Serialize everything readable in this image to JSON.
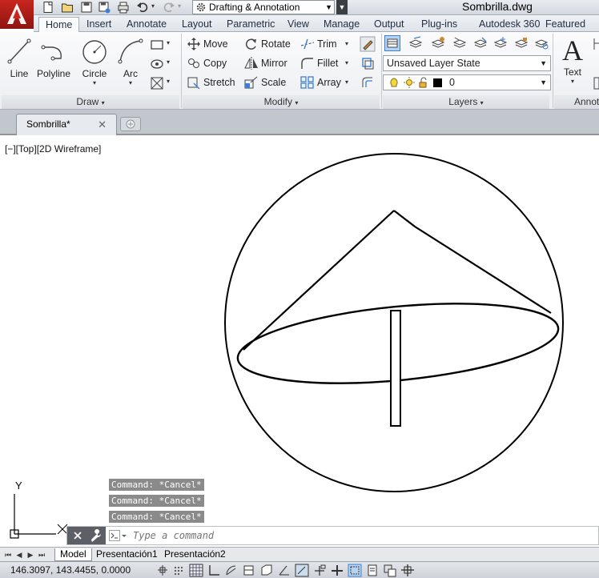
{
  "title_bar": {
    "workspace": "Drafting & Annotation",
    "document_title": "Sombrilla.dwg"
  },
  "ribbon_tabs": [
    {
      "label": "Home"
    },
    {
      "label": "Insert"
    },
    {
      "label": "Annotate"
    },
    {
      "label": "Layout"
    },
    {
      "label": "Parametric"
    },
    {
      "label": "View"
    },
    {
      "label": "Manage"
    },
    {
      "label": "Output"
    },
    {
      "label": "Plug-ins"
    },
    {
      "label": "Autodesk 360"
    },
    {
      "label": "Featured App"
    }
  ],
  "panels": {
    "draw": {
      "title": "Draw",
      "tools": [
        {
          "label": "Line"
        },
        {
          "label": "Polyline"
        },
        {
          "label": "Circle"
        },
        {
          "label": "Arc"
        }
      ]
    },
    "modify": {
      "title": "Modify",
      "tools": [
        {
          "label": "Move"
        },
        {
          "label": "Rotate"
        },
        {
          "label": "Trim"
        },
        {
          "label": "Copy"
        },
        {
          "label": "Mirror"
        },
        {
          "label": "Fillet"
        },
        {
          "label": "Stretch"
        },
        {
          "label": "Scale"
        },
        {
          "label": "Array"
        }
      ]
    },
    "layers": {
      "title": "Layers",
      "layer_state": "Unsaved Layer State",
      "current_layer": "0",
      "current_color": "#000000"
    },
    "annotation": {
      "title": "Annot",
      "text_tool": "Text"
    }
  },
  "file_tab": {
    "label": "Sombrilla*"
  },
  "viewport": {
    "label": "[−][Top][2D Wireframe]",
    "ucs_y": "Y"
  },
  "command": {
    "history": [
      "Command: *Cancel*",
      "Command: *Cancel*",
      "Command: *Cancel*"
    ],
    "placeholder": "Type a command"
  },
  "layout_tabs": [
    {
      "label": "Model"
    },
    {
      "label": "Presentación1"
    },
    {
      "label": "Presentación2"
    }
  ],
  "status_bar": {
    "coordinates": "146.3097, 143.4455, 0.0000"
  },
  "colors": {
    "app_red": "#c8261f",
    "ribbon_bg": "#f2f3f5",
    "command_history_bg": "#8a8a8a"
  }
}
